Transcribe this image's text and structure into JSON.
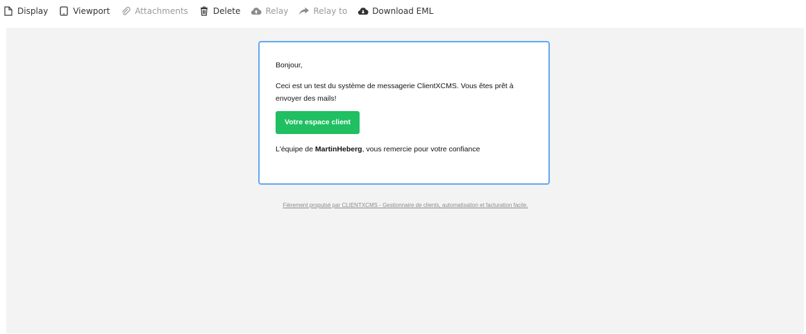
{
  "toolbar": {
    "items": [
      {
        "label": "Display",
        "icon": "document-icon"
      },
      {
        "label": "Viewport",
        "icon": "tablet-icon"
      },
      {
        "label": "Attachments",
        "icon": "paperclip-icon",
        "disabled": true
      },
      {
        "label": "Delete",
        "icon": "trash-icon"
      },
      {
        "label": "Relay",
        "icon": "cloud-upload-icon",
        "disabled": true
      },
      {
        "label": "Relay to",
        "icon": "share-arrow-icon",
        "disabled": true
      },
      {
        "label": "Download EML",
        "icon": "cloud-download-icon"
      }
    ]
  },
  "email": {
    "greeting": "Bonjour,",
    "body": "Ceci est un test du système de messagerie ClientXCMS. Vous êtes prêt à envoyer des mails!",
    "button_label": "Votre espace client",
    "signature_prefix": "L'équipe de ",
    "signature_company": "MartinHeberg",
    "signature_suffix": ", vous remercie pour votre confiance",
    "footer": "Fièrement propulsé par CLIENTXCMS - Gestionnaire de clients, automatisation et facturation facile."
  },
  "colors": {
    "accent_border": "#5fa8ee",
    "button_green": "#1fbf62",
    "preview_background": "#f3f3f3"
  }
}
